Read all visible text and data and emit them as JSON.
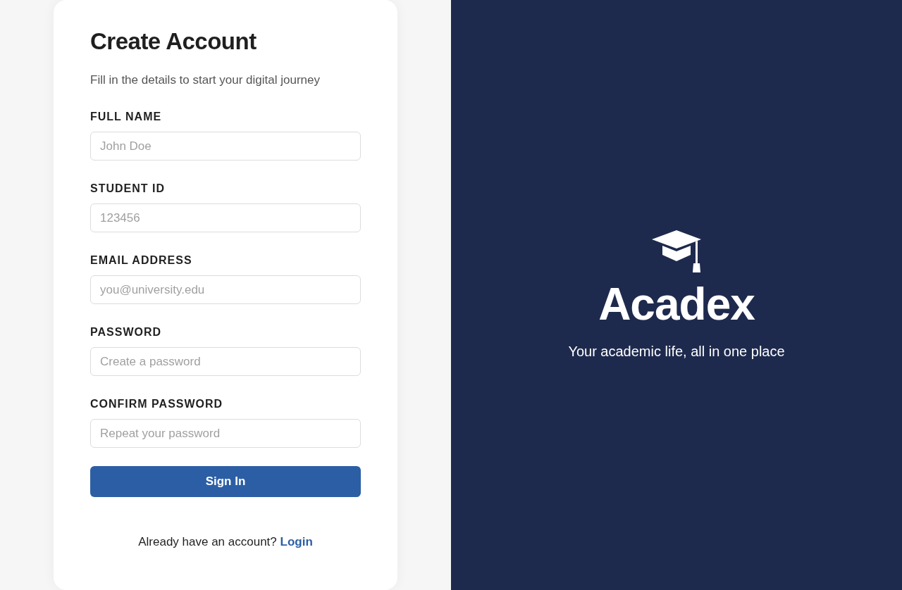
{
  "form": {
    "title": "Create Account",
    "subtitle": "Fill in the details to start your digital journey",
    "fields": [
      {
        "label": "FULL NAME",
        "placeholder": "John Doe"
      },
      {
        "label": "STUDENT ID",
        "placeholder": "123456"
      },
      {
        "label": "EMAIL ADDRESS",
        "placeholder": "you@university.edu"
      },
      {
        "label": "PASSWORD",
        "placeholder": "Create a password"
      },
      {
        "label": "CONFIRM PASSWORD",
        "placeholder": "Repeat your password"
      }
    ],
    "submit_button": "Sign In",
    "footer_text": "Already have an account?",
    "footer_link": "Login"
  },
  "brand": {
    "name": "Acadex",
    "tagline": "Your academic life, all in one place"
  }
}
